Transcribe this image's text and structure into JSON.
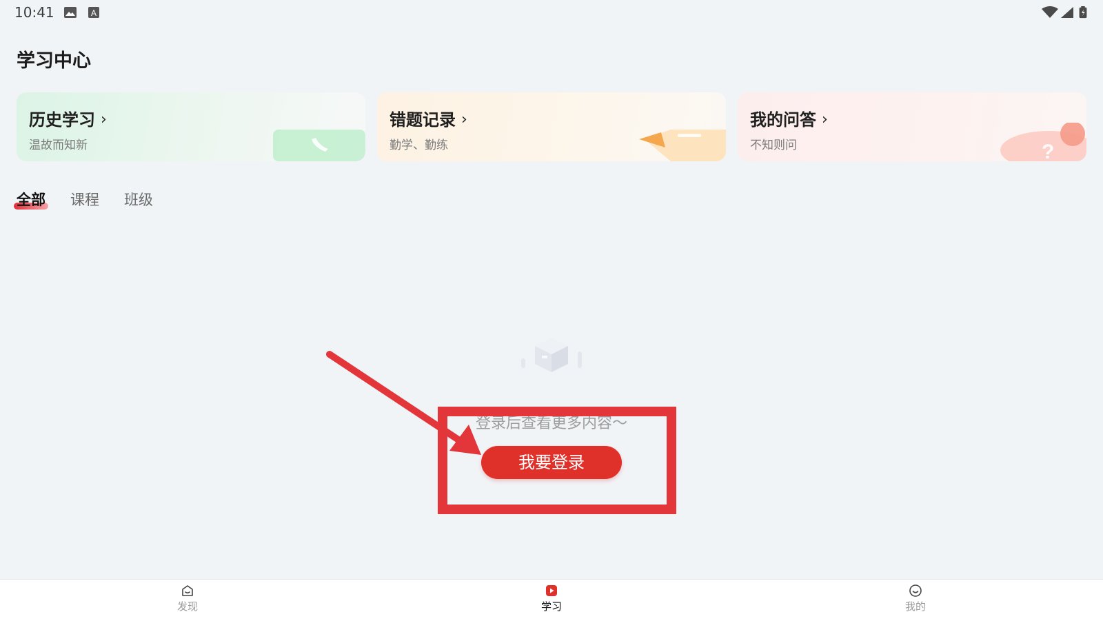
{
  "status_bar": {
    "time": "10:41",
    "icons": [
      "image-icon",
      "a-icon",
      "wifi-icon",
      "signal-icon",
      "battery-icon"
    ]
  },
  "page_title": "学习中心",
  "cards": [
    {
      "title": "历史学习",
      "subtitle": "温故而知新",
      "chevron": "›",
      "icon": "phone-icon",
      "accent": "#8fe3a4"
    },
    {
      "title": "错题记录",
      "subtitle": "勤学、勤练",
      "chevron": "›",
      "icon": "pencil-icon",
      "accent": "#f6b86a"
    },
    {
      "title": "我的问答",
      "subtitle": "不知则问",
      "chevron": "›",
      "icon": "question-icon",
      "accent": "#f6a08c"
    }
  ],
  "tabs": [
    {
      "label": "全部",
      "active": true
    },
    {
      "label": "课程",
      "active": false
    },
    {
      "label": "班级",
      "active": false
    }
  ],
  "empty_state": {
    "text": "登录后查看更多内容～",
    "button": "我要登录",
    "icon": "box-icon"
  },
  "bottom_nav": [
    {
      "label": "发现",
      "icon": "discover-icon",
      "active": false
    },
    {
      "label": "学习",
      "icon": "study-play-icon",
      "active": true
    },
    {
      "label": "我的",
      "icon": "profile-smile-icon",
      "active": false
    }
  ],
  "colors": {
    "accent": "#e0302a",
    "background": "#f1f4f7",
    "annotation": "#e3363b"
  }
}
